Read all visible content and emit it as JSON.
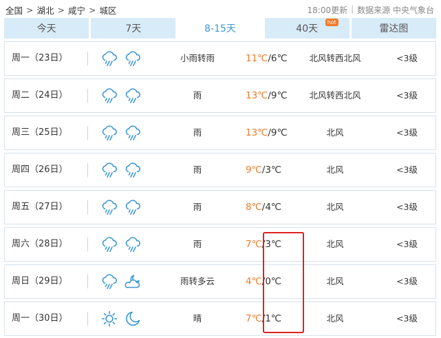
{
  "breadcrumb": [
    "全国",
    "湖北",
    "咸宁",
    "城区"
  ],
  "breadcrumb_sep": ">",
  "update": {
    "time": "18:00更新",
    "source": "数据来源 中央气象台"
  },
  "tabs": [
    {
      "label": "今天",
      "active": false
    },
    {
      "label": "7天",
      "active": false
    },
    {
      "label": "8-15天",
      "active": true
    },
    {
      "label": "40天",
      "active": false,
      "badge": "hot"
    },
    {
      "label": "雷达图",
      "active": false
    }
  ],
  "colors": {
    "accent": "#3b96d6",
    "high_temp": "#f0792a",
    "highlight": "#e02020"
  },
  "forecast": [
    {
      "day": "周一（23日）",
      "icons": [
        "rain-cloud-icon",
        "rain-cloud-icon"
      ],
      "desc": "小雨转雨",
      "high": "11℃",
      "low": "6℃",
      "wind": "北风转西北风",
      "level": "<3级"
    },
    {
      "day": "周二（24日）",
      "icons": [
        "rain-cloud-icon",
        "rain-cloud-icon"
      ],
      "desc": "雨",
      "high": "13℃",
      "low": "9℃",
      "wind": "北风转西北风",
      "level": "<3级"
    },
    {
      "day": "周三（25日）",
      "icons": [
        "rain-cloud-icon",
        "rain-cloud-icon"
      ],
      "desc": "雨",
      "high": "13℃",
      "low": "9℃",
      "wind": "北风",
      "level": "<3级"
    },
    {
      "day": "周四（26日）",
      "icons": [
        "rain-cloud-icon",
        "rain-cloud-icon"
      ],
      "desc": "雨",
      "high": "9℃",
      "low": "3℃",
      "wind": "北风",
      "level": "<3级"
    },
    {
      "day": "周五（27日）",
      "icons": [
        "rain-cloud-icon",
        "rain-cloud-icon"
      ],
      "desc": "雨",
      "high": "8℃",
      "low": "4℃",
      "wind": "北风",
      "level": "<3级"
    },
    {
      "day": "周六（28日）",
      "icons": [
        "rain-cloud-icon",
        "rain-cloud-icon"
      ],
      "desc": "雨",
      "high": "7℃",
      "low": "3℃",
      "wind": "北风",
      "level": "<3级"
    },
    {
      "day": "周日（29日）",
      "icons": [
        "rain-cloud-icon",
        "moon-cloud-icon"
      ],
      "desc": "雨转多云",
      "high": "4℃",
      "low": "0℃",
      "wind": "北风",
      "level": "<3级"
    },
    {
      "day": "周一（30日）",
      "icons": [
        "sun-icon",
        "moon-icon"
      ],
      "desc": "晴",
      "high": "7℃",
      "low": "1℃",
      "wind": "北风",
      "level": "<3级"
    }
  ]
}
